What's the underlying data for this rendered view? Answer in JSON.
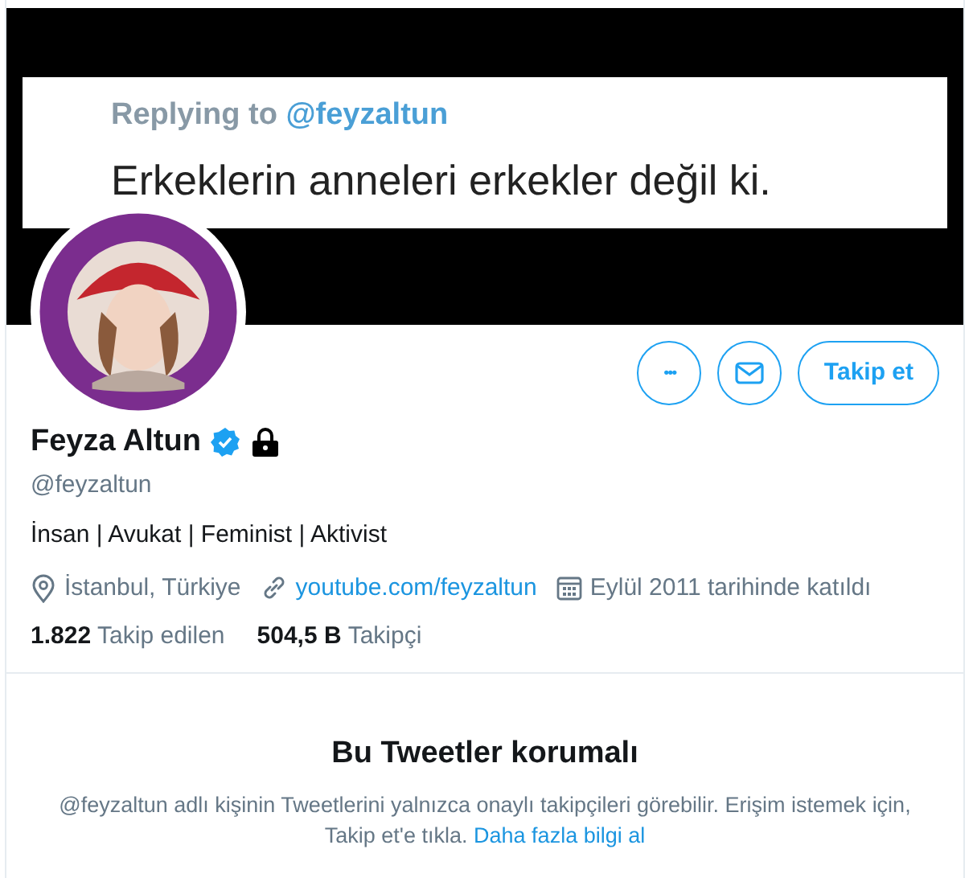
{
  "header": {
    "kind": "screenshot",
    "reply_label": "Replying to",
    "reply_handle": "@feyzaltun",
    "text": "Erkeklerin anneleri erkekler değil ki."
  },
  "actions": {
    "more": "•••",
    "follow": "Takip et"
  },
  "profile": {
    "name": "Feyza Altun",
    "verified": true,
    "protected": true,
    "handle": "@feyzaltun",
    "bio": "İnsan | Avukat | Feminist | Aktivist",
    "location": "İstanbul, Türkiye",
    "link": "youtube.com/feyzaltun",
    "joined": "Eylül 2011 tarihinde katıldı"
  },
  "stats": [
    {
      "count": "1.822",
      "label": "Takip edilen"
    },
    {
      "count": "504,5 B",
      "label": "Takipçi"
    }
  ],
  "protected_notice": {
    "title": "Bu Tweetler korumalı",
    "text": "@feyzaltun adlı kişinin Tweetlerini yalnızca onaylı takipçileri görebilir. Erişim istemek için, Takip et'e tıkla.",
    "link": "Daha fazla bilgi al"
  }
}
